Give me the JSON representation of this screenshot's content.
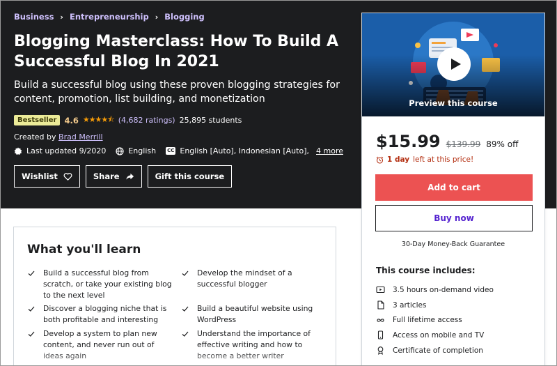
{
  "breadcrumbs": [
    "Business",
    "Entrepreneurship",
    "Blogging"
  ],
  "course": {
    "title": "Blogging Masterclass: How To Build A Successful Blog In 2021",
    "subtitle": "Build a successful blog using these proven blogging strategies for content, promotion, list building, and monetization",
    "badge": "Bestseller",
    "rating": "4.6",
    "stars_value": 4.6,
    "ratings_count": "(4,682 ratings)",
    "students": "25,895 students",
    "created_by_label": "Created by",
    "instructor": "Brad Merrill",
    "last_updated": "Last updated 9/2020",
    "language": "English",
    "captions": "English [Auto], Indonesian [Auto],",
    "captions_more": "4 more"
  },
  "actions": {
    "wishlist": "Wishlist",
    "share": "Share",
    "gift": "Gift this course"
  },
  "sidebar": {
    "preview_label": "Preview this course",
    "price": "$15.99",
    "original_price": "$139.99",
    "discount": "89% off",
    "timer_bold": "1 day",
    "timer_rest": "left at this price!",
    "add_to_cart": "Add to cart",
    "buy_now": "Buy now",
    "guarantee": "30-Day Money-Back Guarantee",
    "includes_title": "This course includes:",
    "includes": [
      {
        "icon": "video-icon",
        "text": "3.5 hours on-demand video"
      },
      {
        "icon": "file-icon",
        "text": "3 articles"
      },
      {
        "icon": "infinity-icon",
        "text": "Full lifetime access"
      },
      {
        "icon": "mobile-icon",
        "text": "Access on mobile and TV"
      },
      {
        "icon": "certificate-icon",
        "text": "Certificate of completion"
      }
    ]
  },
  "learn": {
    "title": "What you'll learn",
    "items": [
      "Build a successful blog from scratch, or take your existing blog to the next level",
      "Develop the mindset of a successful blogger",
      "Discover a blogging niche that is both profitable and interesting",
      "Build a beautiful website using WordPress",
      "Develop a system to plan new content, and never run out of ideas again",
      "Understand the importance of effective writing and how to become a better writer"
    ]
  },
  "colors": {
    "hero_bg": "#1c1d1f",
    "breadcrumb": "#cec0fc",
    "star": "#f69c08",
    "badge_bg": "#eceb98",
    "cart_button": "#ec5252",
    "buy_now_text": "#5624d0",
    "timer": "#b32d0f"
  }
}
